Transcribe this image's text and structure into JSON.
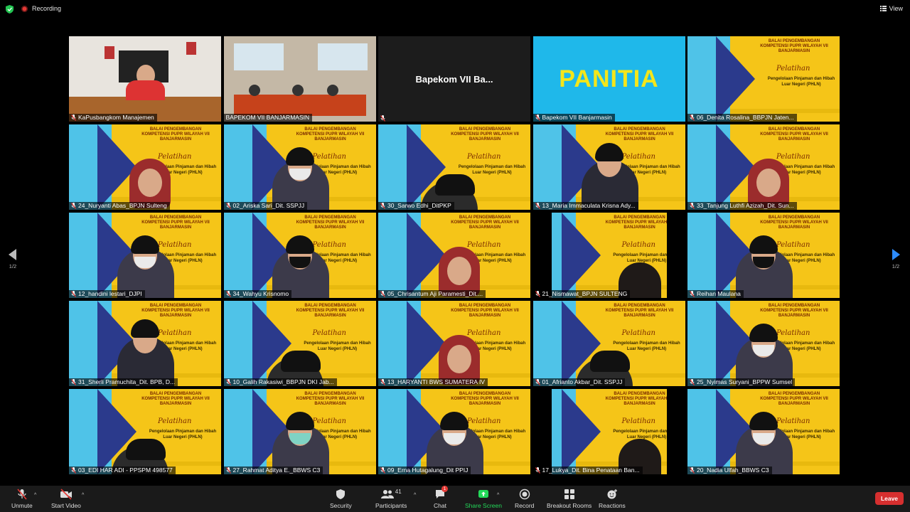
{
  "topbar": {
    "recording_label": "Recording",
    "view_label": "View"
  },
  "pagination": {
    "left": "1/2",
    "right": "1/2"
  },
  "tiles": [
    {
      "name": "KaPusbangkom Manajemen",
      "kind": "office",
      "active": true,
      "muted": true
    },
    {
      "name": "BAPEKOM VII BANJARMASIN",
      "kind": "room",
      "muted": false
    },
    {
      "name": "",
      "kind": "text",
      "text": "Bapekom VII Ba...",
      "muted": true
    },
    {
      "name": "Bapekom VII Banjarmasin",
      "kind": "panitia",
      "text": "PANITIA",
      "muted": true
    },
    {
      "name": "06_Denita Rosalina_BBPJN Jaten...",
      "kind": "banner",
      "muted": true
    },
    {
      "name": "24_Nuryanti Abas_BPJN Sulteng",
      "kind": "banner-hijab",
      "muted": true
    },
    {
      "name": "02_Ariska Sari_Dit. SSPJJ",
      "kind": "banner-mask",
      "muted": true
    },
    {
      "name": "30_Sarwo Edhi_DitPKP",
      "kind": "banner-head",
      "muted": true
    },
    {
      "name": "13_Maria Immaculata Krisna Ady...",
      "kind": "banner-face",
      "muted": true
    },
    {
      "name": "33_Tanjung Luthfi Azizah_Dit. Sun...",
      "kind": "banner-hijab",
      "muted": true
    },
    {
      "name": "12_handini lestari_DJPI",
      "kind": "banner-mask",
      "muted": true
    },
    {
      "name": "34_Wahyu Krisnomo",
      "kind": "banner-blackmask",
      "muted": true
    },
    {
      "name": "05_Chrisantum Aji Paramesti_Dit....",
      "kind": "banner-hijab",
      "muted": true
    },
    {
      "name": "21_Nismawat_BPJN SULTENG",
      "kind": "banner-dark",
      "muted": true
    },
    {
      "name": "Reihan Maulana",
      "kind": "banner-blackmask",
      "muted": true
    },
    {
      "name": "31_Sherli Pramuchita_Dit. BPB, D...",
      "kind": "banner-face",
      "muted": true
    },
    {
      "name": "10_Galih Rakasiwi_BBPJN DKI Jab...",
      "kind": "banner-head",
      "muted": true
    },
    {
      "name": "13_HARYANTI BWS SUMATERA IV",
      "kind": "banner-hijab",
      "muted": true
    },
    {
      "name": "01_Afrianto Akbar_Dit. SSPJJ",
      "kind": "banner-head",
      "muted": true
    },
    {
      "name": "25_Nyimas Suryani_BPPW Sumsel",
      "kind": "banner-mask",
      "muted": true
    },
    {
      "name": "03_EDI HAR ADI - PPSPM 498577",
      "kind": "banner-head",
      "muted": true
    },
    {
      "name": "27_Rahmat Aditya E._BBWS C3",
      "kind": "banner-greenmask",
      "muted": true
    },
    {
      "name": "09_Erna Hutagalung_Dit PPIJ",
      "kind": "banner-mask",
      "muted": true
    },
    {
      "name": "17_Lukya_Dit. Bina Penataan Ban...",
      "kind": "banner-dark",
      "muted": true
    },
    {
      "name": "20_Nadia Ulfah_BBWS C3",
      "kind": "banner-mask",
      "muted": true
    }
  ],
  "banner": {
    "header": "BALAI PENGEMBANGAN KOMPETENSI PUPR WILAYAH VII BANJARMASIN",
    "script": "Pelatihan",
    "subtitle": "Pengelolaan Pinjaman dan Hibah Luar Negeri (PHLN)"
  },
  "toolbar": {
    "unmute": "Unmute",
    "start_video": "Start Video",
    "security": "Security",
    "participants": "Participants",
    "participants_count": "41",
    "chat": "Chat",
    "chat_badge": "1",
    "share_screen": "Share Screen",
    "record": "Record",
    "breakout_rooms": "Breakout Rooms",
    "reactions": "Reactions",
    "leave": "Leave"
  },
  "colors": {
    "banner_yellow": "#f5c518",
    "banner_blue": "#4fc3e8",
    "share_green": "#23d959",
    "leave_red": "#d62f2f",
    "active_border": "#b7e35a"
  }
}
